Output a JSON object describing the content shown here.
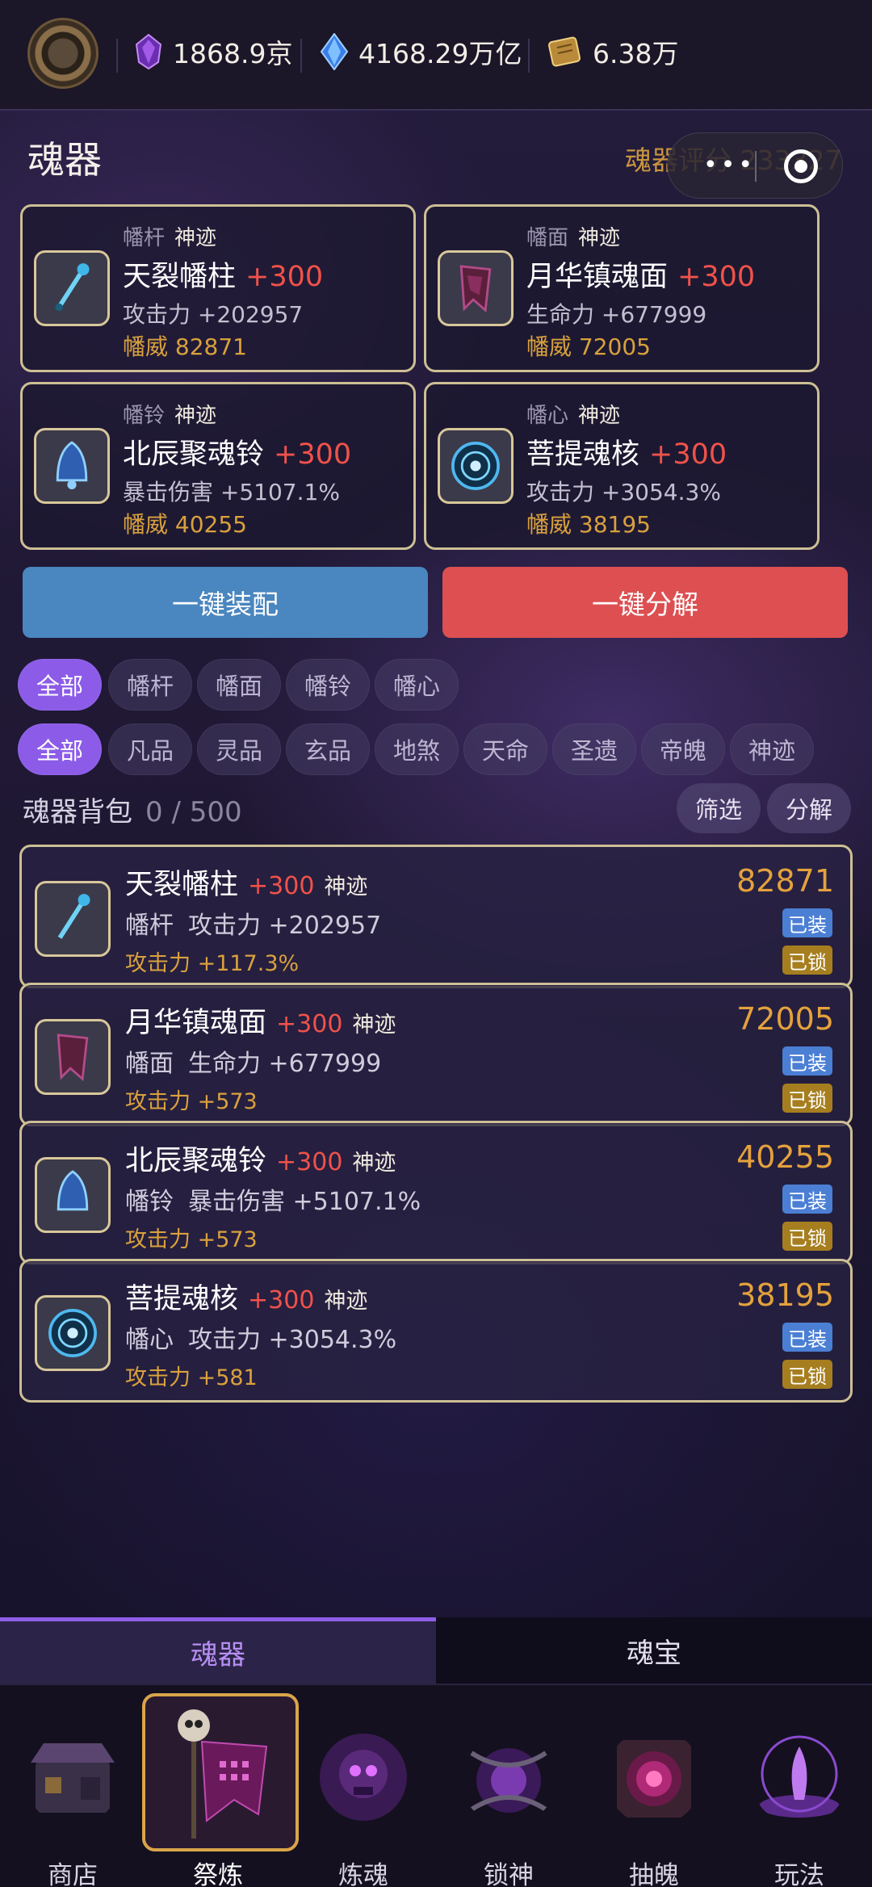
{
  "currencies": [
    {
      "icon": "purple-gem-icon",
      "value": "1868.9京"
    },
    {
      "icon": "blue-crystal-icon",
      "value": "4168.29万亿"
    },
    {
      "icon": "scroll-icon",
      "value": "6.38万"
    }
  ],
  "page": {
    "title": "魂器",
    "score": "魂器评分 233327"
  },
  "slots": [
    {
      "type": "幡杆",
      "grade": "神迹",
      "name": "天裂幡柱",
      "plus": "+300",
      "stat": "攻击力 +202957",
      "power": "幡威 82871"
    },
    {
      "type": "幡面",
      "grade": "神迹",
      "name": "月华镇魂面",
      "plus": "+300",
      "stat": "生命力 +677999",
      "power": "幡威 72005"
    },
    {
      "type": "幡铃",
      "grade": "神迹",
      "name": "北辰聚魂铃",
      "plus": "+300",
      "stat": "暴击伤害 +5107.1%",
      "power": "幡威 40255"
    },
    {
      "type": "幡心",
      "grade": "神迹",
      "name": "菩提魂核",
      "plus": "+300",
      "stat": "攻击力 +3054.3%",
      "power": "幡威 38195"
    }
  ],
  "actions": {
    "equip": "一键装配",
    "decompose": "一键分解"
  },
  "filters": {
    "slot": [
      "全部",
      "幡杆",
      "幡面",
      "幡铃",
      "幡心"
    ],
    "grade": [
      "全部",
      "凡品",
      "灵品",
      "玄品",
      "地煞",
      "天命",
      "圣遗",
      "帝魄",
      "神迹"
    ]
  },
  "bag": {
    "label": "魂器背包",
    "count": "0 / 500",
    "filter_btn": "筛选",
    "decompose_btn": "分解"
  },
  "items": [
    {
      "name": "天裂幡柱",
      "plus": "+300",
      "grade": "神迹",
      "pos": "幡杆",
      "stat": "攻击力 +202957",
      "sub": "攻击力 +117.3%",
      "power": "82871",
      "equipped": "已装",
      "locked": "已锁"
    },
    {
      "name": "月华镇魂面",
      "plus": "+300",
      "grade": "神迹",
      "pos": "幡面",
      "stat": "生命力 +677999",
      "sub": "攻击力 +573",
      "power": "72005",
      "equipped": "已装",
      "locked": "已锁"
    },
    {
      "name": "北辰聚魂铃",
      "plus": "+300",
      "grade": "神迹",
      "pos": "幡铃",
      "stat": "暴击伤害 +5107.1%",
      "sub": "攻击力 +573",
      "power": "40255",
      "equipped": "已装",
      "locked": "已锁"
    },
    {
      "name": "菩提魂核",
      "plus": "+300",
      "grade": "神迹",
      "pos": "幡心",
      "stat": "攻击力 +3054.3%",
      "sub": "攻击力 +581",
      "power": "38195",
      "equipped": "已装",
      "locked": "已锁"
    }
  ],
  "tabs": [
    "魂器",
    "魂宝"
  ],
  "nav": [
    "商店",
    "祭炼",
    "炼魂",
    "锁神",
    "抽魄",
    "玩法"
  ]
}
